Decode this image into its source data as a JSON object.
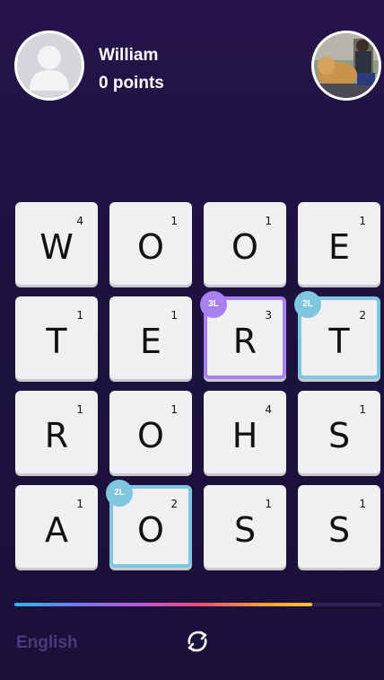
{
  "player": {
    "name": "William",
    "points": "0 points"
  },
  "board": {
    "tiles": [
      {
        "letter": "W",
        "score": "4"
      },
      {
        "letter": "O",
        "score": "1"
      },
      {
        "letter": "O",
        "score": "1"
      },
      {
        "letter": "E",
        "score": "1"
      },
      {
        "letter": "T",
        "score": "1"
      },
      {
        "letter": "E",
        "score": "1"
      },
      {
        "letter": "R",
        "score": "3",
        "modifier": "3L"
      },
      {
        "letter": "T",
        "score": "2",
        "modifier": "2L"
      },
      {
        "letter": "R",
        "score": "1"
      },
      {
        "letter": "O",
        "score": "1"
      },
      {
        "letter": "H",
        "score": "4"
      },
      {
        "letter": "S",
        "score": "1"
      },
      {
        "letter": "A",
        "score": "1"
      },
      {
        "letter": "O",
        "score": "2",
        "modifier": "2L"
      },
      {
        "letter": "S",
        "score": "1"
      },
      {
        "letter": "S",
        "score": "1"
      }
    ],
    "modifier_colors": {
      "3L": "#a980f0",
      "2L": "#7fc6df"
    }
  },
  "progress": {
    "fraction": 0.81
  },
  "footer": {
    "language": "English",
    "shuffle_icon": "refresh-icon"
  }
}
